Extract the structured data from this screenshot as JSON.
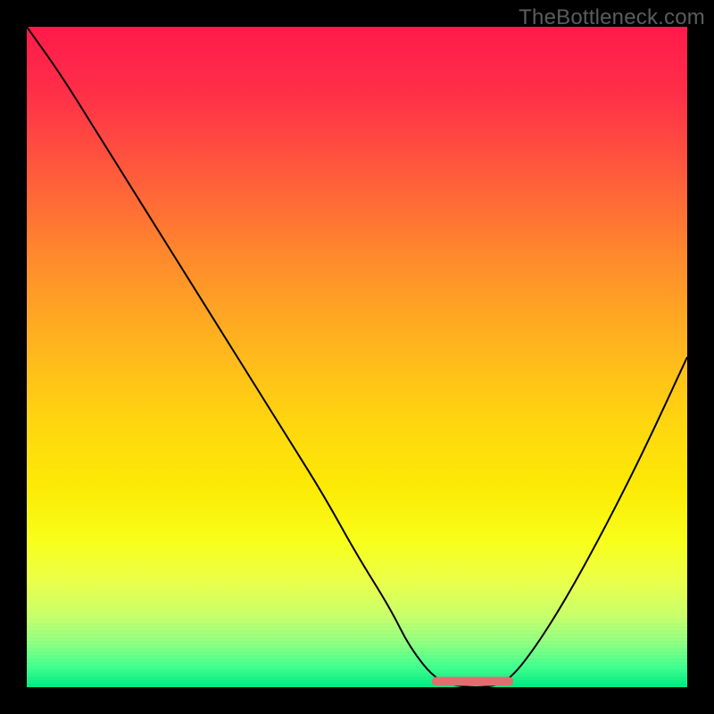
{
  "watermark": "TheBottleneck.com",
  "colors": {
    "frame": "#000000",
    "curve": "#000000",
    "valley_marker": "#e06e6e"
  },
  "chart_data": {
    "type": "line",
    "title": "",
    "xlabel": "",
    "ylabel": "",
    "xlim": [
      0,
      100
    ],
    "ylim": [
      0,
      100
    ],
    "grid": false,
    "legend": false,
    "note": "y is bottleneck %; 0 = bottom (green, no bottleneck), 100 = top (red). x is relative component ratio.",
    "series": [
      {
        "name": "bottleneck-curve",
        "x": [
          0,
          5,
          10,
          15,
          20,
          25,
          30,
          35,
          40,
          45,
          50,
          55,
          58,
          62,
          66,
          70,
          73,
          77,
          82,
          88,
          94,
          100
        ],
        "values": [
          100,
          93,
          85,
          77,
          69,
          61,
          53,
          45,
          37,
          29,
          20,
          12,
          6,
          1,
          0,
          0,
          1,
          6,
          14,
          25,
          37,
          50
        ]
      }
    ],
    "valley_flat_x_range": [
      62,
      73
    ],
    "valley_flat_y": 0,
    "gradient_stops": [
      {
        "pct": 0,
        "color": "#ff1a4b"
      },
      {
        "pct": 50,
        "color": "#ffd60f"
      },
      {
        "pct": 80,
        "color": "#f8ff1b"
      },
      {
        "pct": 100,
        "color": "#00e87f"
      }
    ]
  }
}
